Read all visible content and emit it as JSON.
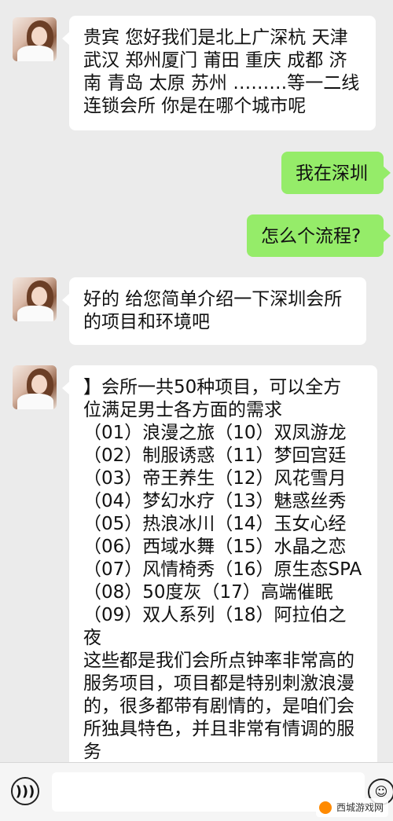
{
  "messages": [
    {
      "side": "left",
      "text": "贵宾 您好我们是北上广深杭 天津\n武汉 郑州厦门 莆田 重庆 成都 济\n南 青岛 太原 苏州 ………等一二线\n连锁会所 你是在哪个城市呢"
    },
    {
      "side": "right",
      "text": "我在深圳"
    },
    {
      "side": "right",
      "text": "怎么个流程?"
    },
    {
      "side": "left",
      "text": "好的 给您简单介绍一下深圳会所\n的项目和环境吧"
    },
    {
      "side": "left",
      "text": "】会所一共50种项目，可以全方\n位满足男士各方面的需求\n（01）浪漫之旅（10）双凤游龙\n（02）制服诱惑（11）梦回宫廷\n（03）帝王养生（12）风花雪月\n（04）梦幻水疗（13）魅惑丝秀\n（05）热浪冰川（14）玉女心经\n（06）西域水舞（15）水晶之恋\n（07）风情椅秀（16）原生态SPA\n（08）50度灰（17）高端催眠\n（09）双人系列（18）阿拉伯之\n夜\n这些都是我们会所点钟率非常高的\n服务项目，项目都是特别刺激浪漫\n的，很多都带有剧情的，是咱们会\n所独具特色，并且非常有情调的服\n务"
    }
  ],
  "input_bar": {
    "voice_icon": "voice-icon",
    "emoji_icon": "emoji-icon",
    "text_value": ""
  },
  "watermark": {
    "text": "西城游戏网"
  },
  "colors": {
    "background": "#ebebeb",
    "bubble_left": "#ffffff",
    "bubble_right": "#95ec69"
  }
}
